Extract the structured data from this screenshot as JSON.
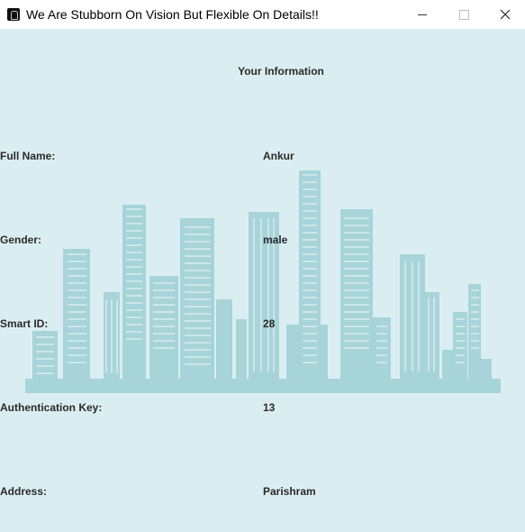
{
  "window": {
    "title": "We Are Stubborn On Vision But Flexible On Details!!"
  },
  "heading": "Your Information",
  "fields": [
    {
      "label": "Full Name:",
      "value": "Ankur"
    },
    {
      "label": "Gender:",
      "value": "male"
    },
    {
      "label": "Smart ID:",
      "value": "28"
    },
    {
      "label": "Authentication Key:",
      "value": "13"
    },
    {
      "label": "Address:",
      "value": "Parishram"
    }
  ],
  "colors": {
    "background": "#daeef2",
    "skyline": "#a6d4d9",
    "text": "#2a2a2a"
  }
}
